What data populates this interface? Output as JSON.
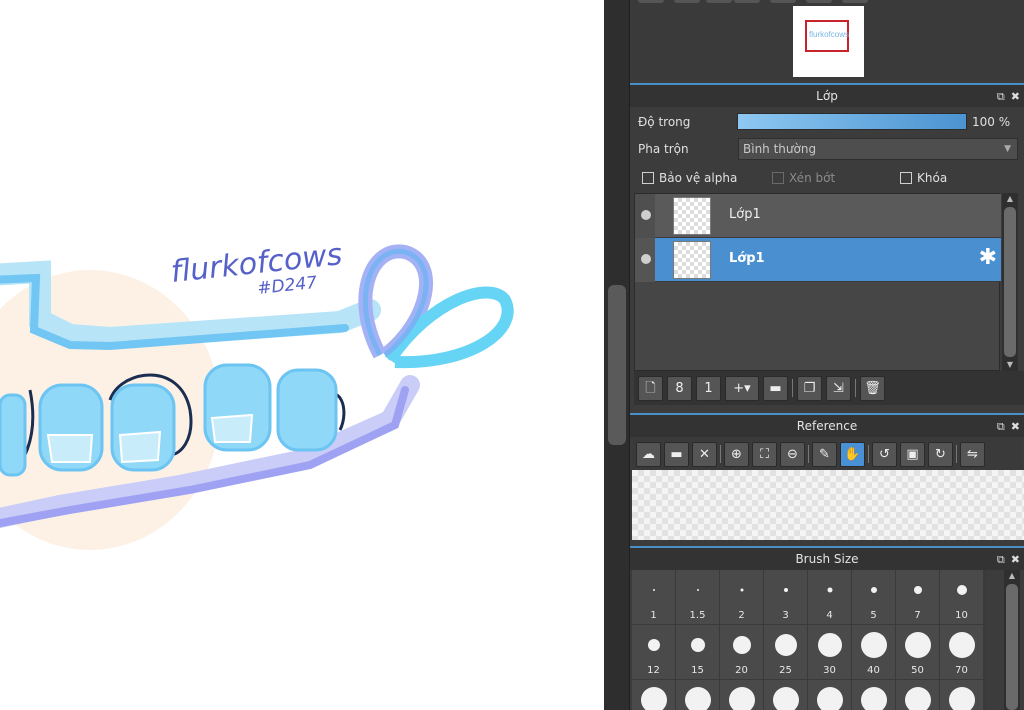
{
  "canvas": {
    "handwriting_line1": "flurkofcows",
    "handwriting_line2": "#D247",
    "art_colors": {
      "outline": "#a7d8f5",
      "stroke": "#6cc4f2",
      "stroke_dark": "#0f2a4a",
      "glow": "#fdeee0",
      "purple": "#9a9cf0"
    }
  },
  "navigator": {
    "thumb_text": "flurkofcows"
  },
  "layer_panel": {
    "title": "Lớp",
    "opacity_label": "Độ trong",
    "opacity_value": "100 %",
    "opacity_fraction": 1.0,
    "blend_label": "Pha trộn",
    "blend_value": "Bình thường",
    "checkboxes": [
      {
        "label": "Bảo vệ alpha",
        "checked": false,
        "enabled": true
      },
      {
        "label": "Xén bớt",
        "checked": false,
        "enabled": false
      },
      {
        "label": "Khóa",
        "checked": false,
        "enabled": true
      }
    ],
    "layers": [
      {
        "name": "Lớp1",
        "selected": false
      },
      {
        "name": "Lớp1",
        "selected": true
      }
    ],
    "toolbar_icons": [
      "new-layer-icon",
      "new-8bit-layer-icon",
      "new-1bit-layer-icon",
      "add-layer-dropdown-icon",
      "folder-icon",
      "duplicate-icon",
      "merge-down-icon",
      "delete-icon"
    ]
  },
  "reference_panel": {
    "title": "Reference",
    "toolbar_icons": [
      "cloud-upload-icon",
      "open-folder-icon",
      "close-icon",
      "zoom-in-icon",
      "fit-icon",
      "zoom-out-icon",
      "eyedropper-icon",
      "hand-icon",
      "rotate-left-icon",
      "fullscreen-icon",
      "rotate-right-icon",
      "flip-icon"
    ],
    "active_tool": "hand-icon"
  },
  "brush_size_panel": {
    "title": "Brush Size",
    "sizes": [
      "1",
      "1.5",
      "2",
      "3",
      "4",
      "5",
      "7",
      "10",
      "12",
      "15",
      "20",
      "25",
      "30",
      "40",
      "50",
      "70"
    ]
  },
  "colors": {
    "accent": "#4a90d4",
    "panel_bg": "#3c3c3c",
    "header_border": "#4a90c8"
  }
}
